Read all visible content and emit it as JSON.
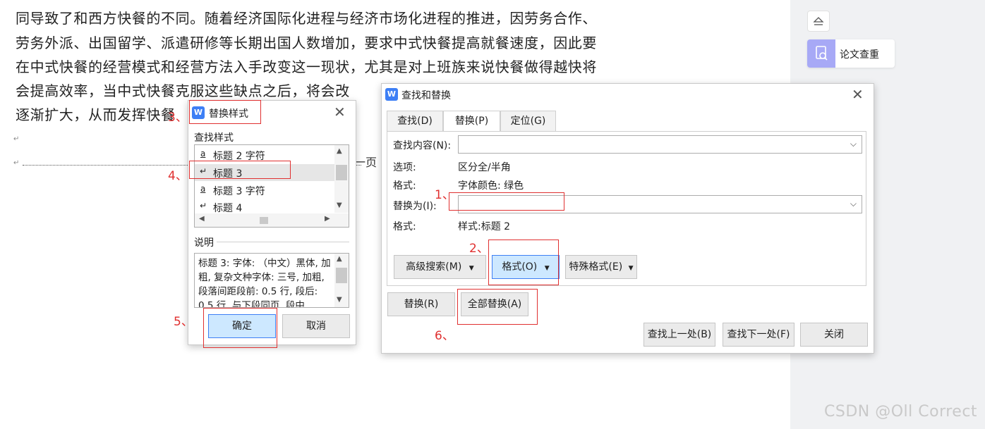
{
  "document": {
    "lines": [
      "同导致了和西方快餐的不同。随着经济国际化进程与经济市场化进程的推进，因劳务合作、",
      "劳务外派、出国留学、派遣研修等长期出国人数增加，要求中式快餐提高就餐速度，因此要",
      "在中式快餐的经营模式和经营方法入手改变这一现状，尤其是对上班族来说快餐做得越快将",
      "会提高效率，当中式快餐克服这些缺点之后，将会改",
      "逐渐扩大，从而发挥快餐"
    ],
    "para_mark": "↵",
    "page_fragment": "一页"
  },
  "right_panel": {
    "card_label": "论文查重"
  },
  "watermark": "CSDN @Oll Correct",
  "replace_style_dialog": {
    "title": "替换样式",
    "find_style_label": "查找样式",
    "styles": [
      {
        "icon": "a",
        "label": "标题 2 字符"
      },
      {
        "icon": "↵",
        "label": "标题 3"
      },
      {
        "icon": "a",
        "label": "标题 3 字符"
      },
      {
        "icon": "↵",
        "label": "标题 4"
      }
    ],
    "description_label": "说明",
    "description_text": "标题 3: 字体: （中文）黑体, 加粗, 复杂文种字体: 三号, 加粗, 段落间距段前: 0.5 行, 段后: 0.5 行, 与下段同页, 段中",
    "ok_label": "确定",
    "cancel_label": "取消"
  },
  "find_replace_dialog": {
    "title": "查找和替换",
    "tabs": [
      "查找(D)",
      "替换(P)",
      "定位(G)"
    ],
    "active_tab": "替换(P)",
    "find_label": "查找内容(N):",
    "find_value": "",
    "options_label": "选项:",
    "options_value": "区分全/半角",
    "format_label": "格式:",
    "format_value": "字体颜色: 绿色",
    "replace_label": "替换为(I):",
    "replace_value": "",
    "format2_label": "格式:",
    "format2_value": "样式:标题 2",
    "advanced_search": "高级搜索(M)",
    "format_button": "格式(O)",
    "special_format": "特殊格式(E)",
    "replace_button": "替换(R)",
    "replace_all_button": "全部替换(A)",
    "find_prev": "查找上一处(B)",
    "find_next": "查找下一处(F)",
    "close": "关闭"
  },
  "annotations": [
    "1、",
    "2、",
    "3、",
    "4、",
    "5、",
    "6、"
  ],
  "colors": {
    "annotation": "#e03030",
    "selected_button": "#cde8ff",
    "accent": "#3d7ff5"
  }
}
